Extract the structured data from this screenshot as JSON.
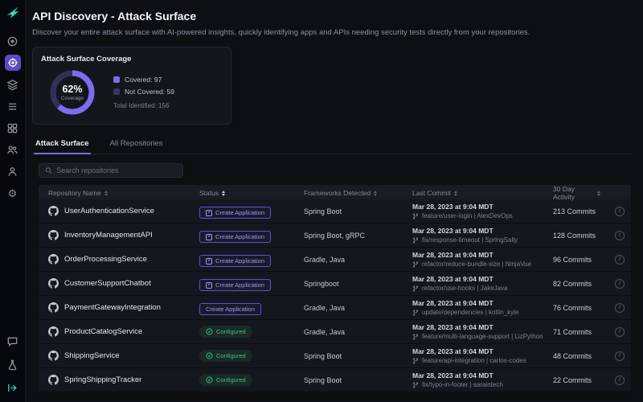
{
  "colors": {
    "accent_purple": "#7d6ce0",
    "accent_teal": "#2fd3c0",
    "green": "#45c07f"
  },
  "sidebar": {
    "icons": [
      "hawk-logo",
      "overview-icon",
      "api-discovery-icon",
      "applications-icon",
      "scan-list-icon",
      "integrations-icon",
      "teams-icon",
      "user-icon",
      "settings-icon",
      "chat-icon",
      "experiments-icon",
      "collapse-arrow-icon"
    ],
    "active": "api-discovery-icon"
  },
  "header": {
    "title": "API Discovery - Attack Surface",
    "subtitle": "Discover your entire attack surface with AI-powered insights, quickly identifying apps and APIs needing security tests directly from your repositories."
  },
  "coverage_card": {
    "title": "Attack Surface Coverage",
    "percent_value": 62,
    "percent_label": "62%",
    "sub_label": "Coverage",
    "legend": [
      {
        "label": "Covered: 97",
        "color": "#7b6cf0"
      },
      {
        "label": "Not Covered: 59",
        "color": "#3a3464"
      }
    ],
    "total_label": "Total Identified: 156"
  },
  "tabs": {
    "items": [
      {
        "label": "Attack Surface",
        "active": true
      },
      {
        "label": "All Repositories",
        "active": false
      }
    ]
  },
  "search": {
    "placeholder": "Search repositories"
  },
  "table": {
    "columns": [
      "Repository Name",
      "Status",
      "Frameworks Detected",
      "Last Commit",
      "30 Day Activity"
    ],
    "rows": [
      {
        "name": "UserAuthenticationService",
        "status_type": "create-plus",
        "status_label": "Create Application",
        "frameworks": "Spring Boot",
        "commit_date": "Mar 28, 2023 at 9:04 MDT",
        "commit_branch": "feature/user-login | AlexDevOps",
        "activity": "213 Commits"
      },
      {
        "name": "InventoryManagementAPI",
        "status_type": "create-plus",
        "status_label": "Create Application",
        "frameworks": "Spring Boot, gRPC",
        "commit_date": "Mar 28, 2023 at 9:04 MDT",
        "commit_branch": "fix/response-timeout | SpringSally",
        "activity": "128 Commits"
      },
      {
        "name": "OrderProcessingService",
        "status_type": "create-plus",
        "status_label": "Create Application",
        "frameworks": "Gradle, Java",
        "commit_date": "Mar 28, 2023 at 9:04 MDT",
        "commit_branch": "refactor/reduce-bundle-size | NinjaVue",
        "activity": "96 Commits"
      },
      {
        "name": "CustomerSupportChatbot",
        "status_type": "create-plus",
        "status_label": "Create Application",
        "frameworks": "Springboot",
        "commit_date": "Mar 28, 2023 at 9:04 MDT",
        "commit_branch": "refactor/use-hooks | JakeJava",
        "activity": "82 Commits"
      },
      {
        "name": "PaymentGatewayIntegration",
        "status_type": "create",
        "status_label": "Create Application",
        "frameworks": "Gradle, Java",
        "commit_date": "Mar 28, 2023 at 9:04 MDT",
        "commit_branch": "update/dependencies | kotlin_kyle",
        "activity": "76 Commits"
      },
      {
        "name": "ProductCatalogService",
        "status_type": "configured",
        "status_label": "Configured",
        "frameworks": "Gradle, Java",
        "commit_date": "Mar 28, 2023 at 9:04 MDT",
        "commit_branch": "feature/multi-language-support | LizPython",
        "activity": "71 Commits"
      },
      {
        "name": "ShippingService",
        "status_type": "configured",
        "status_label": "Configured",
        "frameworks": "Spring Boot",
        "commit_date": "Mar 28, 2023 at 9:04 MDT",
        "commit_branch": "feature/api-integration | carlos-codes",
        "activity": "48 Commits"
      },
      {
        "name": "SpringShippingTracker",
        "status_type": "configured",
        "status_label": "Configured",
        "frameworks": "Spring Boot",
        "commit_date": "Mar 28, 2023 at 9:04 MDT",
        "commit_branch": "fix/typo-in-footer | saraintech",
        "activity": "22 Commits"
      }
    ]
  }
}
